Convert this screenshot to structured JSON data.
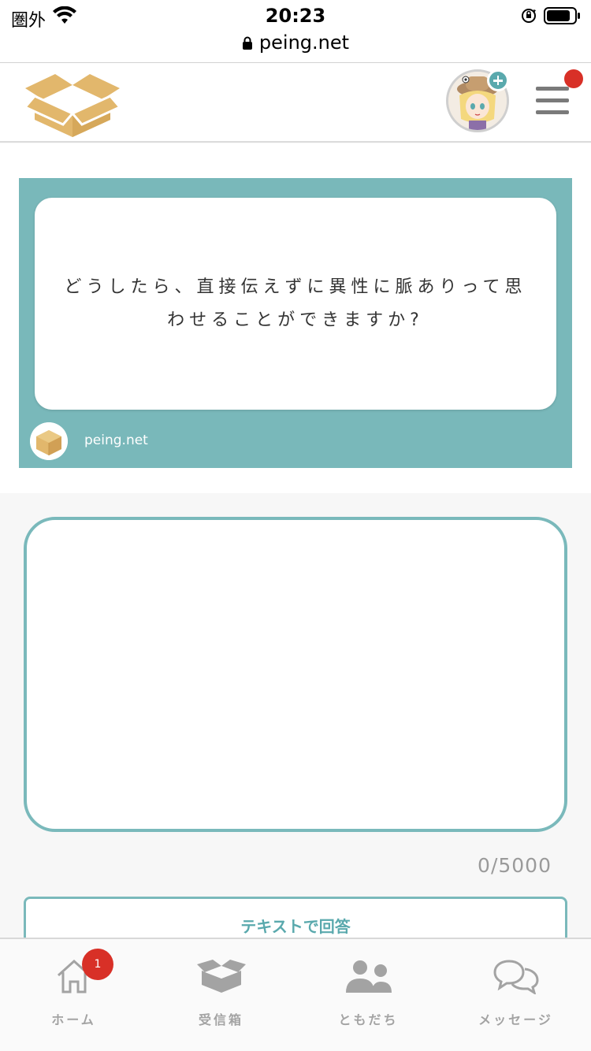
{
  "status_bar": {
    "carrier": "圏外",
    "time": "20:23",
    "url": "peing.net"
  },
  "question": {
    "text": "どうしたら、直接伝えずに異性に脈ありって思わせることができますか?",
    "site": "peing.net"
  },
  "answer": {
    "value": "",
    "counter": "0/5000",
    "submit_label": "テキストで回答"
  },
  "tabs": [
    {
      "label": "ホーム",
      "badge": "1",
      "icon": "home-icon"
    },
    {
      "label": "受信箱",
      "icon": "inbox-box-icon"
    },
    {
      "label": "ともだち",
      "icon": "friends-icon"
    },
    {
      "label": "メッセージ",
      "icon": "message-icon"
    }
  ],
  "colors": {
    "accent": "#79b8ba",
    "badge": "#d83027",
    "logo": "#e2b76c"
  }
}
